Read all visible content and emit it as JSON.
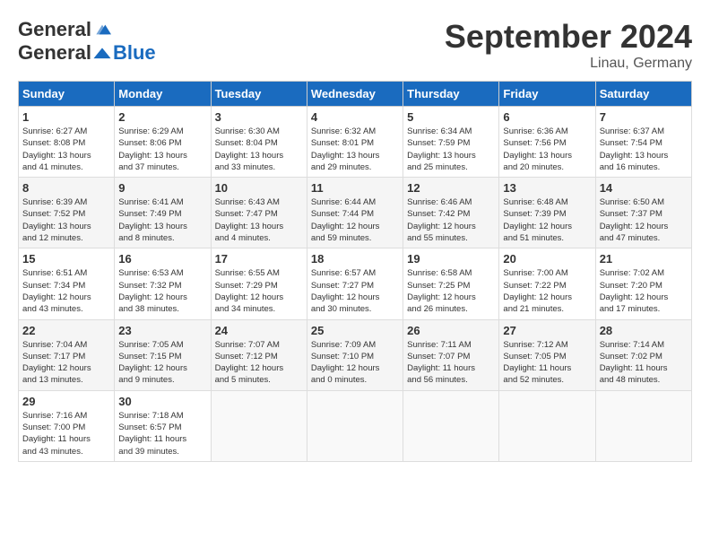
{
  "header": {
    "logo_general": "General",
    "logo_blue": "Blue",
    "month_title": "September 2024",
    "location": "Linau, Germany"
  },
  "days_of_week": [
    "Sunday",
    "Monday",
    "Tuesday",
    "Wednesday",
    "Thursday",
    "Friday",
    "Saturday"
  ],
  "weeks": [
    [
      {
        "day": "1",
        "sunrise": "6:27 AM",
        "sunset": "8:08 PM",
        "daylight": "13 hours and 41 minutes."
      },
      {
        "day": "2",
        "sunrise": "6:29 AM",
        "sunset": "8:06 PM",
        "daylight": "13 hours and 37 minutes."
      },
      {
        "day": "3",
        "sunrise": "6:30 AM",
        "sunset": "8:04 PM",
        "daylight": "13 hours and 33 minutes."
      },
      {
        "day": "4",
        "sunrise": "6:32 AM",
        "sunset": "8:01 PM",
        "daylight": "13 hours and 29 minutes."
      },
      {
        "day": "5",
        "sunrise": "6:34 AM",
        "sunset": "7:59 PM",
        "daylight": "13 hours and 25 minutes."
      },
      {
        "day": "6",
        "sunrise": "6:36 AM",
        "sunset": "7:56 PM",
        "daylight": "13 hours and 20 minutes."
      },
      {
        "day": "7",
        "sunrise": "6:37 AM",
        "sunset": "7:54 PM",
        "daylight": "13 hours and 16 minutes."
      }
    ],
    [
      {
        "day": "8",
        "sunrise": "6:39 AM",
        "sunset": "7:52 PM",
        "daylight": "13 hours and 12 minutes."
      },
      {
        "day": "9",
        "sunrise": "6:41 AM",
        "sunset": "7:49 PM",
        "daylight": "13 hours and 8 minutes."
      },
      {
        "day": "10",
        "sunrise": "6:43 AM",
        "sunset": "7:47 PM",
        "daylight": "13 hours and 4 minutes."
      },
      {
        "day": "11",
        "sunrise": "6:44 AM",
        "sunset": "7:44 PM",
        "daylight": "12 hours and 59 minutes."
      },
      {
        "day": "12",
        "sunrise": "6:46 AM",
        "sunset": "7:42 PM",
        "daylight": "12 hours and 55 minutes."
      },
      {
        "day": "13",
        "sunrise": "6:48 AM",
        "sunset": "7:39 PM",
        "daylight": "12 hours and 51 minutes."
      },
      {
        "day": "14",
        "sunrise": "6:50 AM",
        "sunset": "7:37 PM",
        "daylight": "12 hours and 47 minutes."
      }
    ],
    [
      {
        "day": "15",
        "sunrise": "6:51 AM",
        "sunset": "7:34 PM",
        "daylight": "12 hours and 43 minutes."
      },
      {
        "day": "16",
        "sunrise": "6:53 AM",
        "sunset": "7:32 PM",
        "daylight": "12 hours and 38 minutes."
      },
      {
        "day": "17",
        "sunrise": "6:55 AM",
        "sunset": "7:29 PM",
        "daylight": "12 hours and 34 minutes."
      },
      {
        "day": "18",
        "sunrise": "6:57 AM",
        "sunset": "7:27 PM",
        "daylight": "12 hours and 30 minutes."
      },
      {
        "day": "19",
        "sunrise": "6:58 AM",
        "sunset": "7:25 PM",
        "daylight": "12 hours and 26 minutes."
      },
      {
        "day": "20",
        "sunrise": "7:00 AM",
        "sunset": "7:22 PM",
        "daylight": "12 hours and 21 minutes."
      },
      {
        "day": "21",
        "sunrise": "7:02 AM",
        "sunset": "7:20 PM",
        "daylight": "12 hours and 17 minutes."
      }
    ],
    [
      {
        "day": "22",
        "sunrise": "7:04 AM",
        "sunset": "7:17 PM",
        "daylight": "12 hours and 13 minutes."
      },
      {
        "day": "23",
        "sunrise": "7:05 AM",
        "sunset": "7:15 PM",
        "daylight": "12 hours and 9 minutes."
      },
      {
        "day": "24",
        "sunrise": "7:07 AM",
        "sunset": "7:12 PM",
        "daylight": "12 hours and 5 minutes."
      },
      {
        "day": "25",
        "sunrise": "7:09 AM",
        "sunset": "7:10 PM",
        "daylight": "12 hours and 0 minutes."
      },
      {
        "day": "26",
        "sunrise": "7:11 AM",
        "sunset": "7:07 PM",
        "daylight": "11 hours and 56 minutes."
      },
      {
        "day": "27",
        "sunrise": "7:12 AM",
        "sunset": "7:05 PM",
        "daylight": "11 hours and 52 minutes."
      },
      {
        "day": "28",
        "sunrise": "7:14 AM",
        "sunset": "7:02 PM",
        "daylight": "11 hours and 48 minutes."
      }
    ],
    [
      {
        "day": "29",
        "sunrise": "7:16 AM",
        "sunset": "7:00 PM",
        "daylight": "11 hours and 43 minutes."
      },
      {
        "day": "30",
        "sunrise": "7:18 AM",
        "sunset": "6:57 PM",
        "daylight": "11 hours and 39 minutes."
      },
      null,
      null,
      null,
      null,
      null
    ]
  ]
}
